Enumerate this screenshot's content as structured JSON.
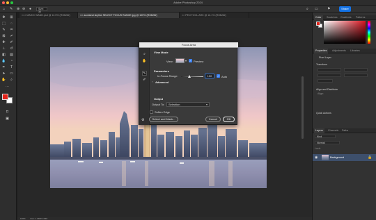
{
  "app": {
    "title": "Adobe Photoshop 2024"
  },
  "options_bar": {
    "size_value": "Size: 30",
    "share_label": "Share"
  },
  "tabs": [
    {
      "label": "××× MAGIC WAND.psd @ 12.5% (RGB/8#)"
    },
    {
      "label": "×× auckland skyline SELECT FOCUS RANGE.jpg @ 100% (RGB/8#)"
    },
    {
      "label": "×× PEN TOOL.ARK @ 16.1% (RGB/8#)"
    }
  ],
  "color": {
    "foreground": "#e3241b",
    "background": "#ffffff",
    "field_hue": "#d8141f"
  },
  "right_panel": {
    "color_tabs": [
      "Color",
      "Swatches",
      "Gradients",
      "Patterns"
    ],
    "prop_tabs": [
      "Properties",
      "Adjustments",
      "Libraries"
    ],
    "pixel_layer": "Pixel Layer",
    "transform": "Transform",
    "align": "Align and Distribute",
    "align_sub": "Align:",
    "quick_actions": "Quick Actions",
    "layer_tabs": [
      "Layers",
      "Channels",
      "Paths"
    ],
    "kind": "Kind",
    "normal": "Normal",
    "lock": "Lock:",
    "layer_name": "Background"
  },
  "dialog": {
    "title": "Focus Area",
    "view_mode": "View Mode",
    "view": "View:",
    "preview": "Preview",
    "parameters": "Parameters",
    "in_focus_range": "In-Focus Range:",
    "range_value": "100",
    "range_level": 0.38,
    "auto": "Auto",
    "advanced": "Advanced",
    "output": "Output",
    "output_to": "Output To:",
    "output_option": "Selection",
    "soften_edge": "Soften Edge",
    "select_mask": "Select and Mask...",
    "cancel": "Cancel",
    "ok": "OK"
  },
  "status": {
    "zoom": "100%",
    "doc_info": "Doc: 1.34M/1.34M"
  }
}
